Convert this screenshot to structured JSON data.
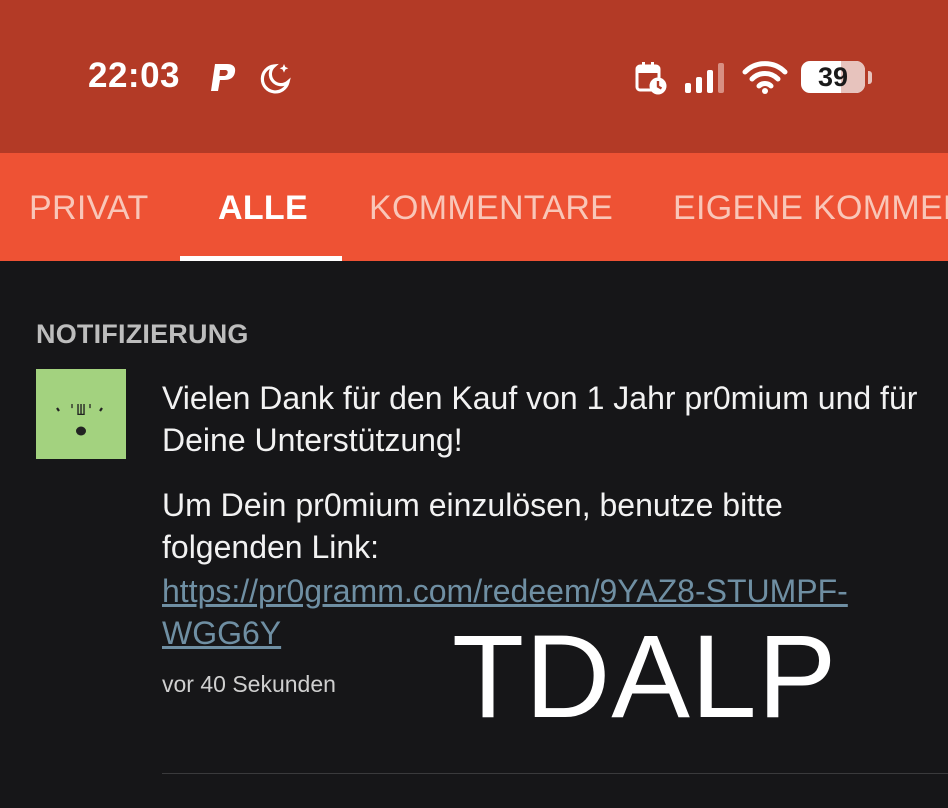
{
  "status_bar": {
    "time": "22:03",
    "battery_level": "39",
    "battery_percent": 62,
    "icons": [
      "paypal-icon",
      "do-not-disturb-moon-icon",
      "calendar-clock-icon",
      "cellular-signal-icon",
      "wifi-icon",
      "battery-icon"
    ]
  },
  "tabs": [
    {
      "label": "PRIVAT",
      "active": false
    },
    {
      "label": "ALLE",
      "active": true
    },
    {
      "label": "KOMMENTARE",
      "active": false
    },
    {
      "label": "EIGENE KOMMENTARE",
      "active": false
    }
  ],
  "section": {
    "header": "NOTIFIZIERUNG"
  },
  "notification": {
    "message_line1": "Vielen Dank für den Kauf von 1 Jahr pr0mium und für Deine Unterstützung!",
    "message_line2": "Um Dein pr0mium einzulösen, benutze bitte folgenden Link:",
    "link_text": "https://pr0gramm.com/redeem/9YAZ8-STUMPF-WGG6Y",
    "timestamp": "vor 40 Sekunden"
  },
  "overlay": {
    "watermark_text": "TDALP"
  },
  "colors": {
    "status_bar_bg": "#b33a26",
    "tab_bar_bg": "#ee5234",
    "content_bg": "#161618",
    "link": "#6f8fa3",
    "avatar_bg": "#a3d27f"
  }
}
